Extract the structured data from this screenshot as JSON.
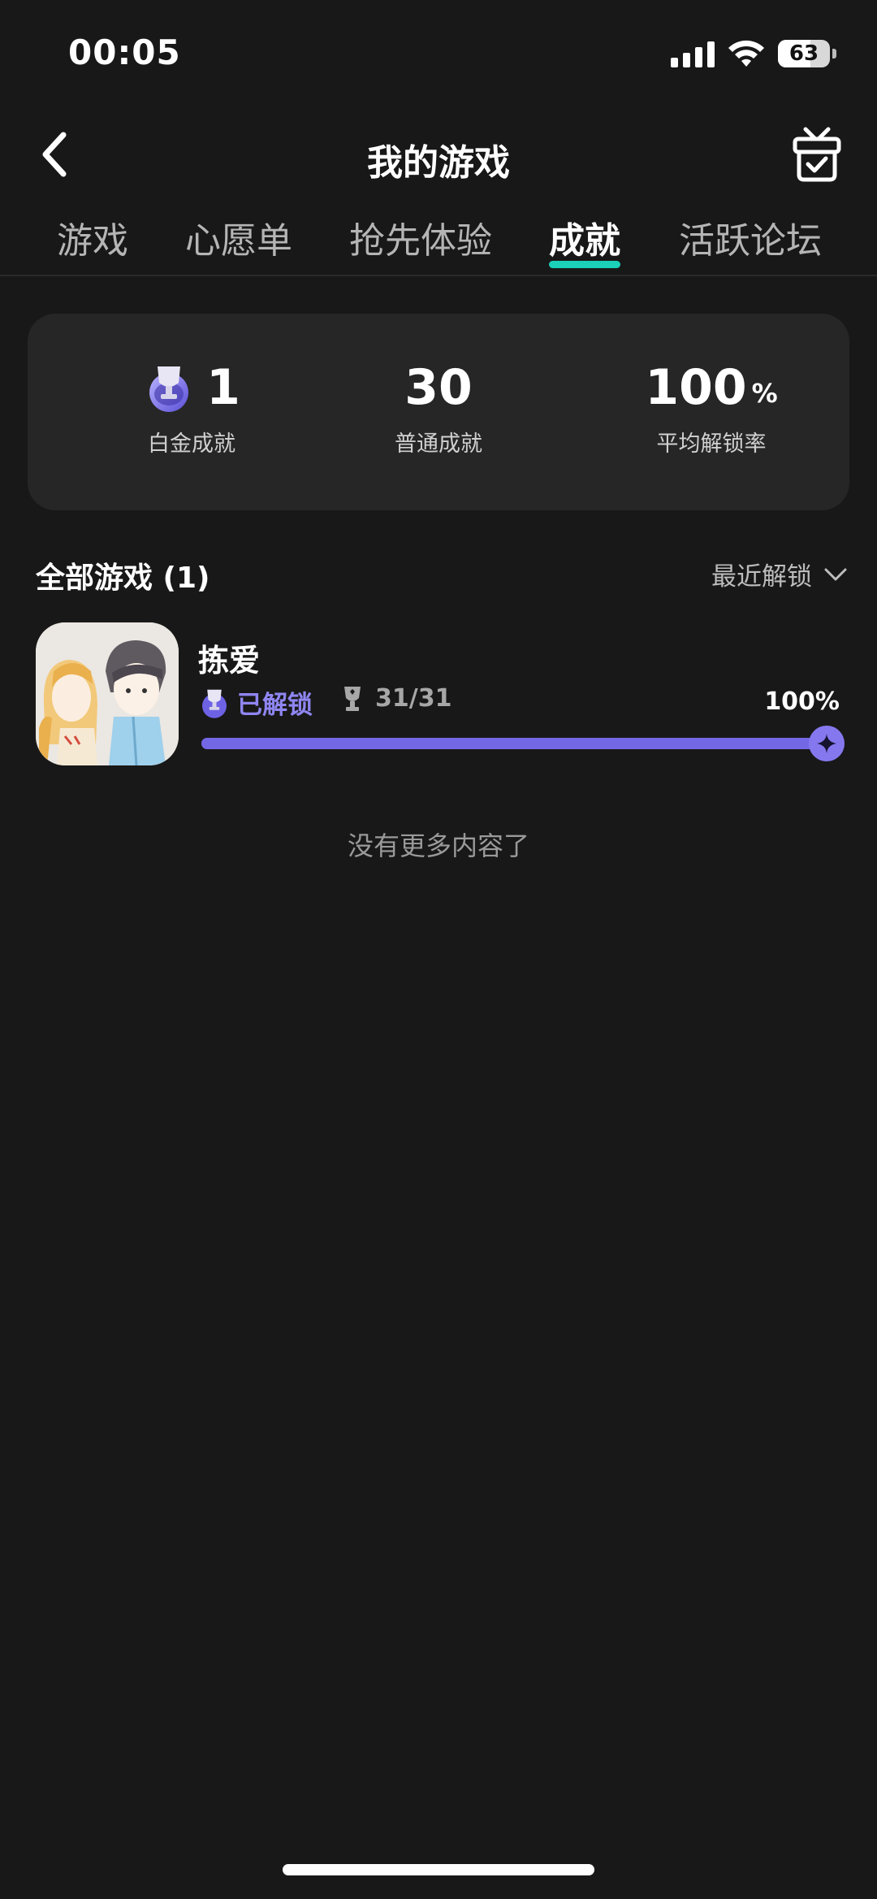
{
  "status_bar": {
    "time": "00:05",
    "battery": "63",
    "battery_level": 0.63
  },
  "nav": {
    "title": "我的游戏",
    "back_icon": "chevron-left-icon",
    "gift_icon": "gift-box-icon"
  },
  "tabs": [
    {
      "label": "游戏",
      "active": false
    },
    {
      "label": "心愿单",
      "active": false
    },
    {
      "label": "抢先体验",
      "active": false
    },
    {
      "label": "成就",
      "active": true
    },
    {
      "label": "活跃论坛",
      "active": false
    }
  ],
  "stats": {
    "platinum": {
      "value": "1",
      "label": "白金成就",
      "icon": "platinum-trophy-icon"
    },
    "normal": {
      "value": "30",
      "label": "普通成就"
    },
    "rate": {
      "value": "100",
      "unit": "%",
      "label": "平均解锁率"
    }
  },
  "section": {
    "title": "全部游戏 (1)",
    "sort_label": "最近解锁",
    "sort_icon": "chevron-down-icon"
  },
  "games": [
    {
      "name": "拣爱",
      "status": "已解锁",
      "trophy_count": "31/31",
      "percent": "100%",
      "progress": 1.0,
      "accent": "#7467e6"
    }
  ],
  "footer": {
    "no_more": "没有更多内容了"
  },
  "colors": {
    "background": "#181818",
    "card": "#262626",
    "tab_indicator": "#1ad0b9",
    "accent_purple": "#7467e6"
  }
}
